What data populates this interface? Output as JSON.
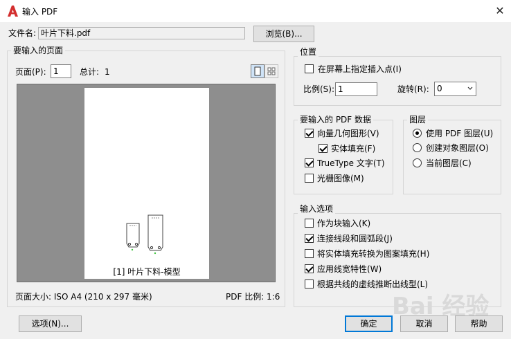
{
  "window": {
    "title": "输入 PDF",
    "close_glyph": "✕"
  },
  "file": {
    "label": "文件名:",
    "value": "叶片下料.pdf",
    "browse_label": "浏览(B)..."
  },
  "pages": {
    "group_label": "要输入的页面",
    "page_label": "页面(P):",
    "page_value": "1",
    "total_label": "总计:",
    "total_value": "1",
    "preview_caption": "[1] 叶片下料-模型",
    "page_size": "页面大小: ISO A4 (210 x 297 毫米)",
    "pdf_scale": "PDF 比例: 1:6"
  },
  "position": {
    "group_label": "位置",
    "specify_on_screen_label": "在屏幕上指定插入点(I)",
    "specify_on_screen_checked": false,
    "scale_label": "比例(S):",
    "scale_value": "1",
    "rotation_label": "旋转(R):",
    "rotation_value": "0"
  },
  "pdf_data": {
    "group_label": "要输入的 PDF 数据",
    "items": [
      {
        "label": "向量几何图形(V)",
        "checked": true
      },
      {
        "label": "实体填充(F)",
        "checked": true
      },
      {
        "label": "TrueType 文字(T)",
        "checked": true
      },
      {
        "label": "光栅图像(M)",
        "checked": false
      }
    ]
  },
  "layers": {
    "group_label": "图层",
    "options": [
      {
        "label": "使用 PDF 图层(U)",
        "selected": true
      },
      {
        "label": "创建对象图层(O)",
        "selected": false
      },
      {
        "label": "当前图层(C)",
        "selected": false
      }
    ]
  },
  "import_options": {
    "group_label": "输入选项",
    "items": [
      {
        "label": "作为块输入(K)",
        "checked": false
      },
      {
        "label": "连接线段和圆弧段(J)",
        "checked": true
      },
      {
        "label": "将实体填充转换为图案填充(H)",
        "checked": false
      },
      {
        "label": "应用线宽特性(W)",
        "checked": true
      },
      {
        "label": "根据共线的虚线推断出线型(L)",
        "checked": false
      }
    ]
  },
  "buttons": {
    "options": "选项(N)...",
    "ok": "确定",
    "cancel": "取消",
    "help": "帮助"
  },
  "watermark": {
    "text": "Bai 经验"
  },
  "colors": {
    "accent": "#0078d7",
    "app_red": "#d32f2f",
    "preview_bg": "#8e8e8e"
  },
  "icons": {
    "app": "autocad-a-icon",
    "close": "close-icon",
    "single_page": "single-page-view-icon",
    "thumbnails": "thumbnail-grid-view-icon",
    "dropdown": "chevron-down-icon"
  }
}
